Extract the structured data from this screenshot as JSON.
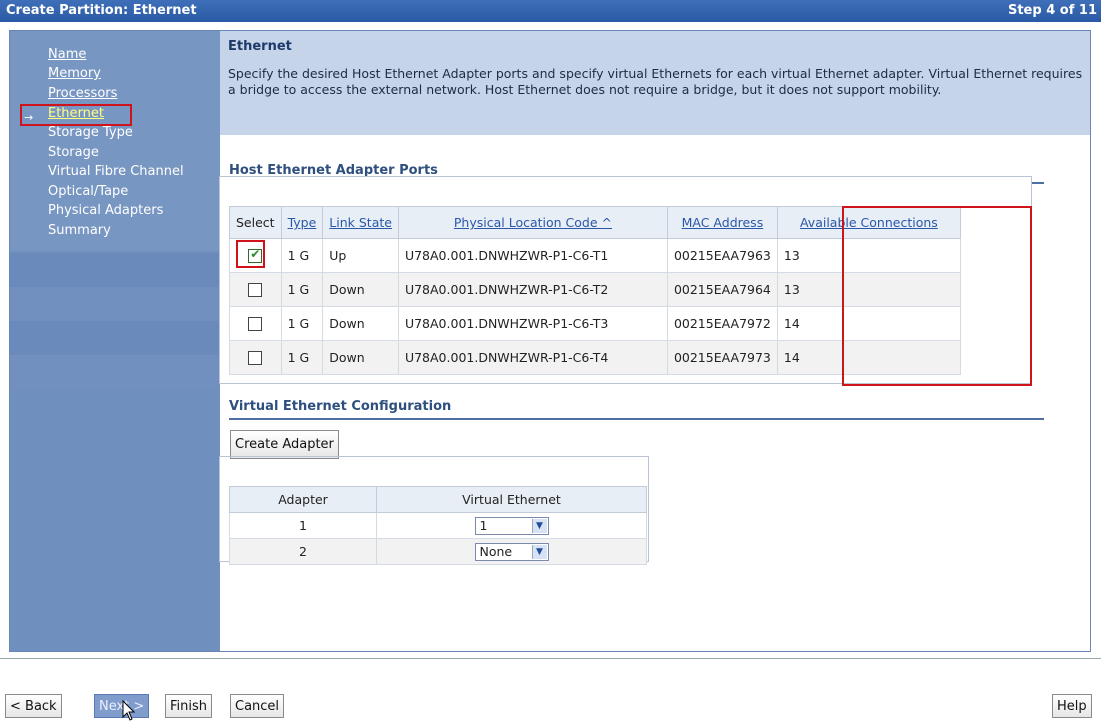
{
  "window": {
    "title": "Create Partition: Ethernet",
    "step": "Step 4 of 11"
  },
  "nav": {
    "items": [
      {
        "label": "Name",
        "state": "link"
      },
      {
        "label": "Memory",
        "state": "link"
      },
      {
        "label": "Processors",
        "state": "link"
      },
      {
        "label": "Ethernet",
        "state": "current"
      },
      {
        "label": "Storage Type",
        "state": "plain"
      },
      {
        "label": "Storage",
        "state": "plain"
      },
      {
        "label": "Virtual Fibre Channel",
        "state": "plain"
      },
      {
        "label": "Optical/Tape",
        "state": "plain"
      },
      {
        "label": "Physical Adapters",
        "state": "plain"
      },
      {
        "label": "Summary",
        "state": "plain"
      }
    ],
    "current_marker": "→"
  },
  "page": {
    "heading": "Ethernet",
    "description": "Specify the desired Host Ethernet Adapter ports and specify virtual Ethernets for each virtual Ethernet adapter. Virtual Ethernet requires a bridge to access the external network. Host Ethernet does not require a bridge, but it does not support mobility."
  },
  "hea": {
    "title": "Host Ethernet Adapter Ports",
    "columns": [
      "Select",
      "Type",
      "Link State",
      "Physical Location Code ^",
      "MAC Address",
      "Available Connections"
    ],
    "rows": [
      {
        "selected": true,
        "type": "1 G",
        "link_state": "Up",
        "location": "U78A0.001.DNWHZWR-P1-C6-T1",
        "mac": "00215EAA7963",
        "available": "13"
      },
      {
        "selected": false,
        "type": "1 G",
        "link_state": "Down",
        "location": "U78A0.001.DNWHZWR-P1-C6-T2",
        "mac": "00215EAA7964",
        "available": "13"
      },
      {
        "selected": false,
        "type": "1 G",
        "link_state": "Down",
        "location": "U78A0.001.DNWHZWR-P1-C6-T3",
        "mac": "00215EAA7972",
        "available": "14"
      },
      {
        "selected": false,
        "type": "1 G",
        "link_state": "Down",
        "location": "U78A0.001.DNWHZWR-P1-C6-T4",
        "mac": "00215EAA7973",
        "available": "14"
      }
    ]
  },
  "ve": {
    "title": "Virtual Ethernet Configuration",
    "create_button": "Create Adapter",
    "columns": [
      "Adapter",
      "Virtual Ethernet"
    ],
    "rows": [
      {
        "adapter": "1",
        "value": "1"
      },
      {
        "adapter": "2",
        "value": "None"
      }
    ]
  },
  "footer": {
    "back": "< Back",
    "next": "Next >",
    "finish": "Finish",
    "cancel": "Cancel",
    "help": "Help"
  },
  "colors": {
    "titlebar": "#2a5aa5",
    "nav": "#6f8fbe",
    "highlight": "#d0121b",
    "current_nav": "#ffff80"
  }
}
